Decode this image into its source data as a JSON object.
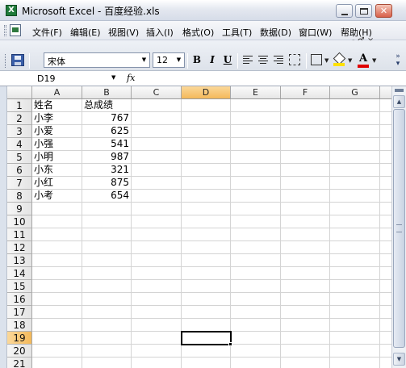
{
  "window": {
    "title": "Microsoft Excel - 百度经验.xls",
    "app_icon_letter": "X"
  },
  "menu": {
    "items": [
      "文件(F)",
      "编辑(E)",
      "视图(V)",
      "插入(I)",
      "格式(O)",
      "工具(T)",
      "数据(D)",
      "窗口(W)",
      "帮助(H)"
    ],
    "doc_controls": "- ♂ ×"
  },
  "toolbar": {
    "font_name": "宋体",
    "font_size": "12",
    "bold": "B",
    "italic": "I",
    "underline": "U",
    "font_color_label": "A"
  },
  "formula_bar": {
    "name_box": "D19",
    "fx": "fx",
    "formula": ""
  },
  "sheet": {
    "columns": [
      "A",
      "B",
      "C",
      "D",
      "E",
      "F",
      "G"
    ],
    "active_column": "D",
    "active_row": 19,
    "rows": [
      "1",
      "2",
      "3",
      "4",
      "5",
      "6",
      "7",
      "8",
      "9",
      "10",
      "11",
      "12",
      "13",
      "14",
      "15",
      "16",
      "17",
      "18",
      "19",
      "20",
      "21"
    ],
    "data": [
      [
        "姓名",
        "总成绩"
      ],
      [
        "小李",
        "767"
      ],
      [
        "小爱",
        "625"
      ],
      [
        "小强",
        "541"
      ],
      [
        "小明",
        "987"
      ],
      [
        "小东",
        "321"
      ],
      [
        "小红",
        "875"
      ],
      [
        "小考",
        "654"
      ]
    ]
  }
}
